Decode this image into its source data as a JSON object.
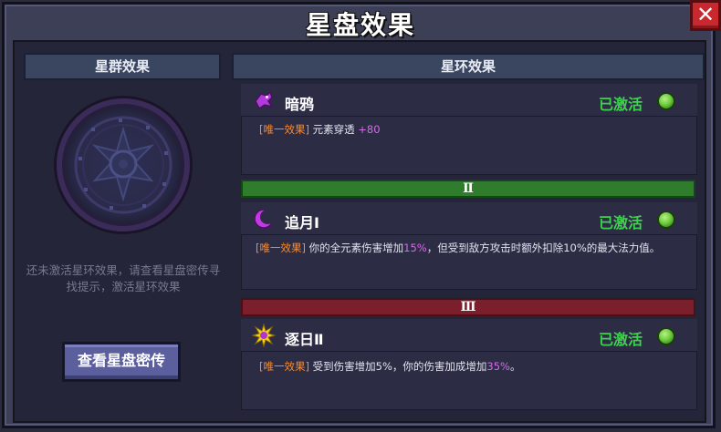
{
  "window": {
    "title": "星盘效果",
    "close_label": "✕"
  },
  "left": {
    "header": "星群效果",
    "hint": "还未激活星环效果，请查看星盘密传寻找提示，激活星环效果",
    "button": "查看星盘密传"
  },
  "right": {
    "header": "星环效果",
    "effects": [
      {
        "name": "暗鸦",
        "status": "已激活",
        "tag": "[唯一效果]",
        "text": " 元素穿透 ",
        "value": "+80",
        "icon": "raven-icon"
      },
      {
        "tier": "Ⅱ",
        "name": "追月Ⅰ",
        "status": "已激活",
        "tag": "[唯一效果]",
        "text_a": " 你的全元素伤害增加",
        "value_a": "15%",
        "text_b": "，但受到敌方攻击时额外扣除10%的最大法力值。",
        "icon": "crescent-moon-icon"
      },
      {
        "tier": "Ⅲ",
        "name": "逐日Ⅱ",
        "status": "已激活",
        "tag": "[唯一效果]",
        "text_a": " 受到伤害增加5%，你的伤害加成增加",
        "value_a": "35%",
        "text_b": "。",
        "icon": "sun-icon"
      }
    ]
  },
  "colors": {
    "active_green": "#3ed24d",
    "tag_orange": "#ff8a2a",
    "value_purple": "#d46be8",
    "tier2_bar": "#2f7d2c",
    "tier3_bar": "#7b1f2c",
    "close_red": "#c8282e"
  }
}
